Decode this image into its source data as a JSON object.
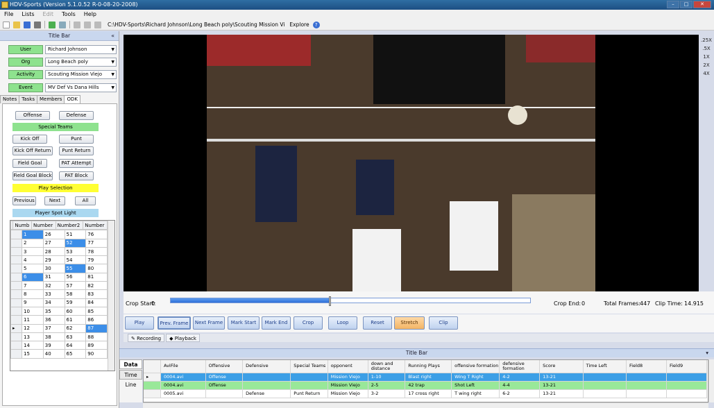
{
  "window": {
    "title": "HDV-Sports (Version 5.1.0.52 R-0-08-20-2008)"
  },
  "menu": [
    "File",
    "Lists",
    "Edit",
    "Tools",
    "Help"
  ],
  "toolbar": {
    "path": "C:\\HDV-Sports\\Richard Johnson\\Long Beach poly\\Scouting Mission Vi",
    "explore": "Explore"
  },
  "left": {
    "title": "Title Bar",
    "fields": [
      {
        "label": "User",
        "value": "Richard Johnson"
      },
      {
        "label": "Org",
        "value": "Long Beach poly"
      },
      {
        "label": "Activity",
        "value": "Scouting Mission Viejo"
      },
      {
        "label": "Event",
        "value": "MV Def Vs Dana Hills"
      }
    ],
    "tabs": [
      "Notes",
      "Tasks",
      "Members",
      "ODK"
    ],
    "odk": {
      "offense": "Offense",
      "defense": "Defense",
      "special_teams": "Special Teams",
      "kick_off": "Kick Off",
      "punt": "Punt",
      "kick_off_return": "Kick Off Return",
      "punt_return": "Punt Return",
      "field_goal": "Field Goal",
      "pat_attempt": "PAT Attempt",
      "field_goal_block": "Field Goal Block",
      "pat_block": "PAT Block",
      "play_selection": "Play Selection",
      "previous": "Previous",
      "next": "Next",
      "all": "All",
      "player_spot_light": "Player Spot Light"
    },
    "grid_headers": [
      "Numb",
      "Number",
      "Number2",
      "Number"
    ],
    "grid_rows": [
      [
        "1",
        "26",
        "51",
        "76"
      ],
      [
        "2",
        "27",
        "52",
        "77"
      ],
      [
        "3",
        "28",
        "53",
        "78"
      ],
      [
        "4",
        "29",
        "54",
        "79"
      ],
      [
        "5",
        "30",
        "55",
        "80"
      ],
      [
        "6",
        "31",
        "56",
        "81"
      ],
      [
        "7",
        "32",
        "57",
        "82"
      ],
      [
        "8",
        "33",
        "58",
        "83"
      ],
      [
        "9",
        "34",
        "59",
        "84"
      ],
      [
        "10",
        "35",
        "60",
        "85"
      ],
      [
        "11",
        "36",
        "61",
        "86"
      ],
      [
        "12",
        "37",
        "62",
        "87"
      ],
      [
        "13",
        "38",
        "63",
        "88"
      ],
      [
        "14",
        "39",
        "64",
        "89"
      ],
      [
        "15",
        "40",
        "65",
        "90"
      ]
    ]
  },
  "speeds": [
    ".25X",
    ".5X",
    "1X",
    "2X",
    "4X"
  ],
  "crop": {
    "start_label": "Crop Start:",
    "start": "0",
    "end_label": "Crop End:",
    "end": "0",
    "total_label": "Total Frames:",
    "total": "447",
    "clip_label": "Clip Time:",
    "clip": "14.915",
    "position_fraction": 0.44
  },
  "controls": [
    "Play",
    "Prev. Frame",
    "Next Frame",
    "Mark Start",
    "Mark End",
    "Crop",
    "Loop",
    "Reset",
    "Stretch",
    "Clip"
  ],
  "mode_tabs": [
    "Recording",
    "Playback"
  ],
  "bottom": {
    "title": "Title Bar",
    "side_tabs": [
      "Data",
      "Time Line"
    ],
    "columns": [
      "AviFile",
      "Offensive",
      "Defensive",
      "Special Teams",
      "opponent",
      "down and distance",
      "Running Plays",
      "offensive formation",
      "defensive formation",
      "Score",
      "Time Left",
      "Field8",
      "Field9"
    ],
    "rows": [
      [
        "0004.avi",
        "Offense",
        "",
        "",
        "Mission Viejo",
        "1-10",
        "Blast right",
        "Wing T Right",
        "4-2",
        "13-21",
        "",
        "",
        ""
      ],
      [
        "0004.avi",
        "Offense",
        "",
        "",
        "Mission Viejo",
        "2-5",
        "42 trap",
        "Shot Left",
        "4-4",
        "13-21",
        "",
        "",
        ""
      ],
      [
        "0005.avi",
        "",
        "Defense",
        "Punt Return",
        "Mission Viejo",
        "3-2",
        "17 cross right",
        "T wing right",
        "6-2",
        "13-21",
        "",
        "",
        ""
      ]
    ]
  }
}
